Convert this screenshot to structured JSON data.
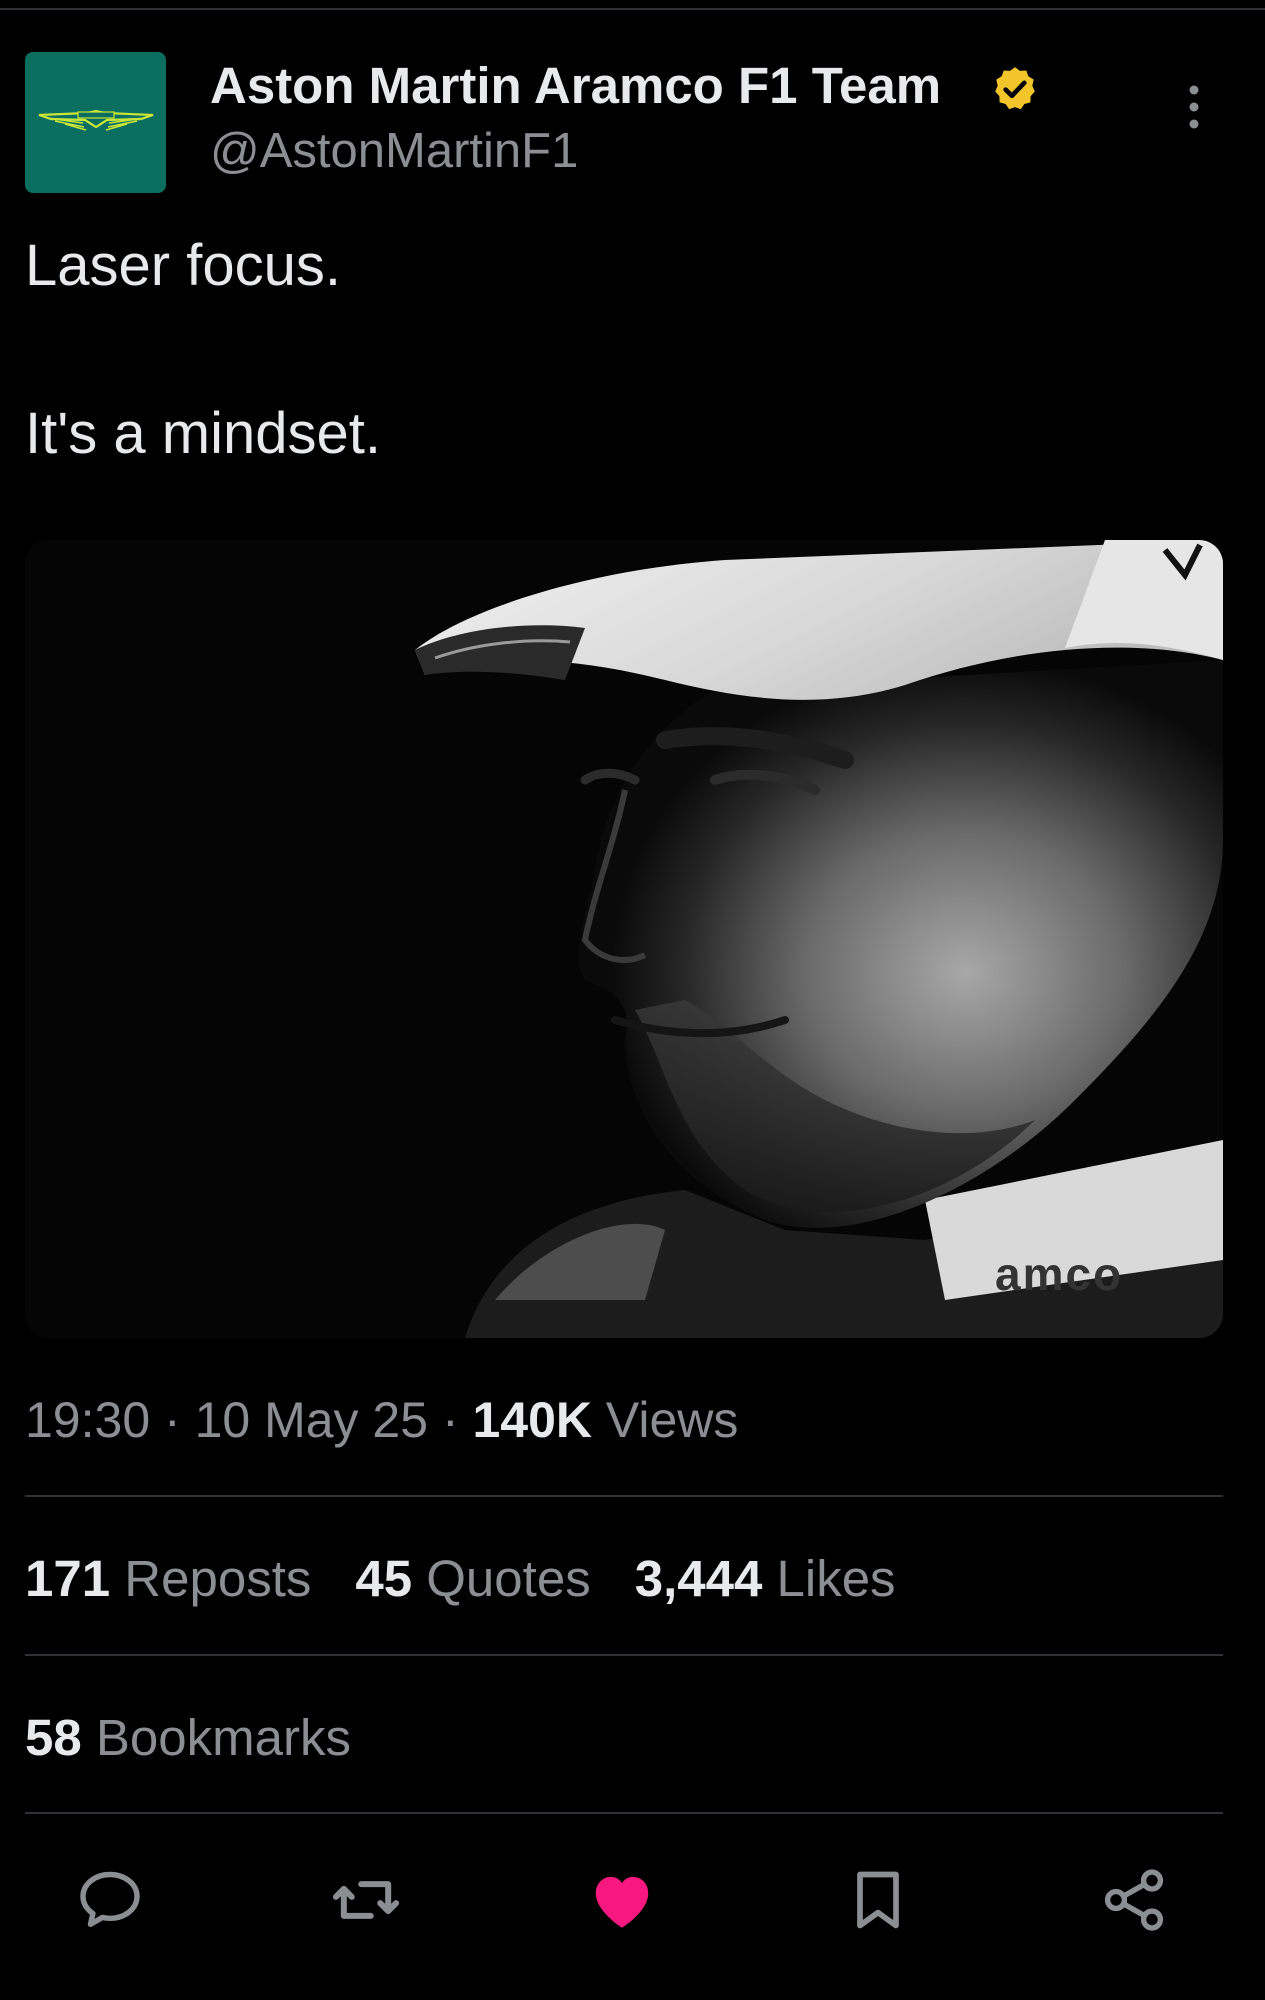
{
  "author": {
    "display_name": "Aston Martin Aramco F1 Team",
    "handle": "@AstonMartinF1",
    "verified_color": "#f2c52b",
    "avatar_bg": "#0b6e5f"
  },
  "tweet": {
    "line1": "Laser focus.",
    "line2": "It's a mindset."
  },
  "meta": {
    "time": "19:30",
    "sep1": " · ",
    "date": "10 May 25",
    "sep2": " · ",
    "views_count": "140K",
    "views_label": " Views"
  },
  "stats": {
    "reposts_count": "171",
    "reposts_label": "Reposts",
    "quotes_count": "45",
    "quotes_label": "Quotes",
    "likes_count": "3,444",
    "likes_label": "Likes",
    "bookmarks_count": "58",
    "bookmarks_label": "Bookmarks"
  },
  "media": {
    "photo_text": "amco"
  },
  "actions": [
    "reply-icon",
    "repost-icon",
    "like-icon",
    "bookmark-icon",
    "share-icon"
  ],
  "colors": {
    "like": "#f91880",
    "muted": "#8b8f94",
    "text": "#e7e9ea"
  }
}
